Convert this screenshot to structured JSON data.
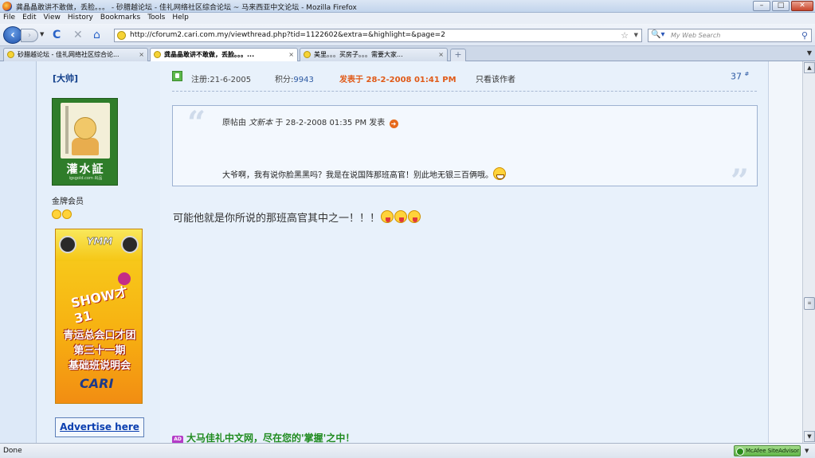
{
  "window": {
    "title": "龚晶晶敢讲不敢做，丢脸。。。 - 砂腊越论坛 - 佳礼网络社区综合论坛 ~ 马来西亚中文论坛 - Mozilla Firefox",
    "buttons": {
      "minimize": "–",
      "maximize": "□",
      "close": "✕"
    }
  },
  "menubar": [
    "File",
    "Edit",
    "View",
    "History",
    "Bookmarks",
    "Tools",
    "Help"
  ],
  "navbar": {
    "url": "http://cforum2.cari.com.my/viewthread.php?tid=1122602&extra=&highlight=&page=2",
    "search_placeholder": "My Web Search",
    "back": "‹",
    "forward": "›",
    "reload": "C",
    "stop": "✕",
    "home": "⌂"
  },
  "tabs": [
    {
      "label": "砂腊越论坛 - 佳礼网络社区综合论...",
      "close": "×",
      "active": false
    },
    {
      "label": "龚晶晶敢讲不敢做，丢脸。。。...",
      "close": "×",
      "active": true
    },
    {
      "label": "美里。。。买房子。。。需要大家...",
      "close": "×",
      "active": false
    }
  ],
  "newtab": "+",
  "post": {
    "rank": "[大帅]",
    "avatar_text": "灌水証",
    "avatar_small": "igsgold.com 出品",
    "user_group": "金牌会员",
    "register": "注册:21-6-2005",
    "credits_label": "积分:",
    "credits_value": "9943",
    "posted": "发表于 28-2-2008 01:41 PM",
    "only_author": "只看该作者",
    "floor": "37",
    "floor_sup": "#",
    "quote": {
      "head_prefix": "原帖由 ",
      "author": "文新本",
      "head_suffix": " 于 28-2-2008 01:35 PM 发表",
      "body": "大爷啊，我有说你脸黑黑吗？我是在说国阵那班高官！别此地无银三百俩哦。"
    },
    "message": "可能他就是你所说的那班高官其中之一！！！",
    "signature": "大马佳礼中文网，尽在您的'掌握'之中！"
  },
  "sidebar_ad": {
    "brand": "YMM",
    "show": "SHOW才31",
    "line1": "青运总会口才团",
    "line2": "第三十一期",
    "line3": "基础班说明会",
    "cari": "CARI"
  },
  "advertise": "Advertise here",
  "statusbar": {
    "done": "Done",
    "mcafee": "McAfee SiteAdvisor"
  }
}
